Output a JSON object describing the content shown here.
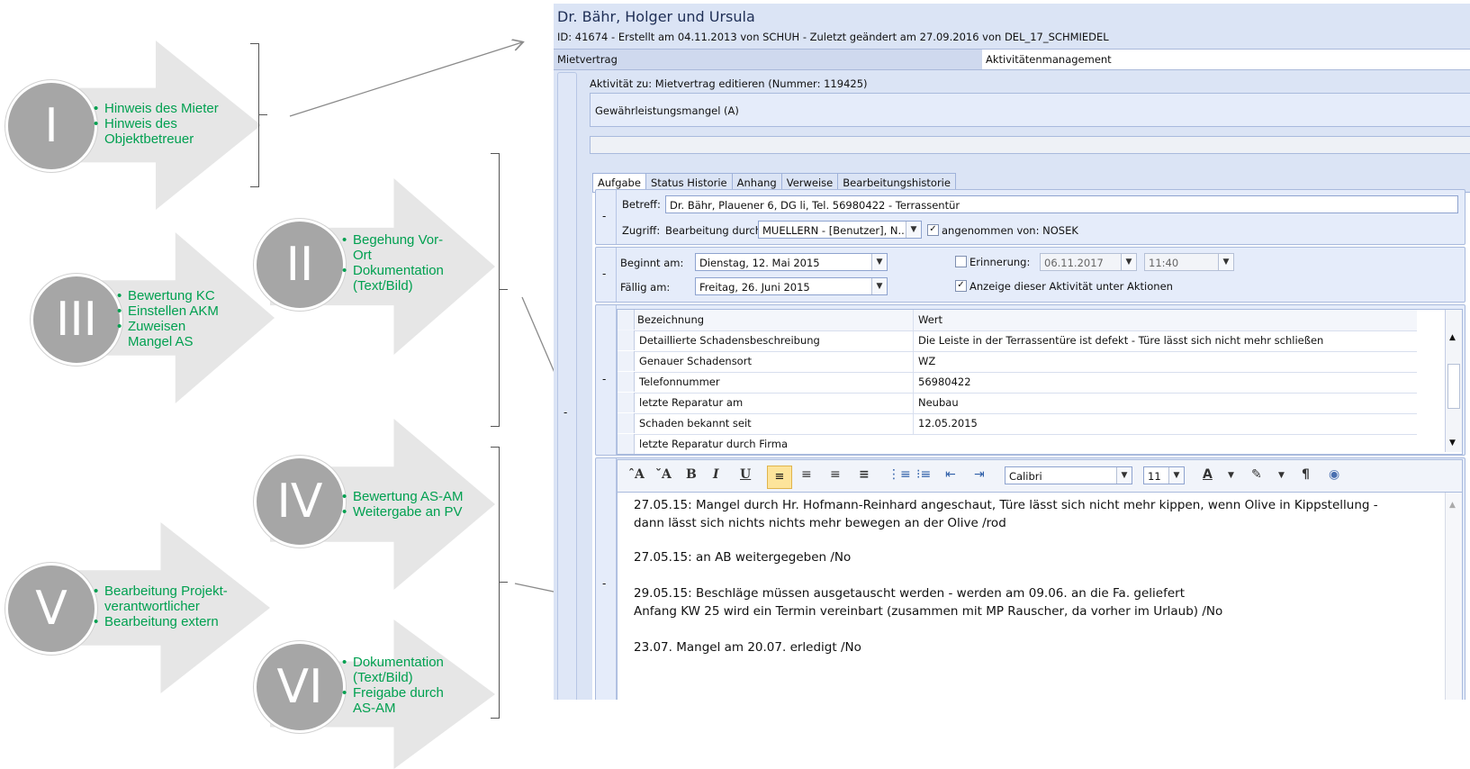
{
  "diagram": {
    "steps": [
      {
        "numeral": "I",
        "items": [
          "Hinweis des Mieter",
          "Hinweis  des Objektbetreuer"
        ]
      },
      {
        "numeral": "II",
        "items": [
          "Begehung Vor-Ort",
          "Dokumentation (Text/Bild)"
        ]
      },
      {
        "numeral": "III",
        "items": [
          "Bewertung KC",
          "Einstellen AKM",
          "Zuweisen Mangel AS"
        ]
      },
      {
        "numeral": "IV",
        "items": [
          "Bewertung AS-AM",
          "Weitergabe an PV"
        ]
      },
      {
        "numeral": "V",
        "items": [
          "Bearbeitung Projekt-verantwortlicher",
          "Bearbeitung extern"
        ]
      },
      {
        "numeral": "VI",
        "items": [
          "Dokumentation (Text/Bild)",
          "Freigabe durch AS-AM"
        ]
      }
    ],
    "colors": {
      "text_green": "#00a050",
      "badge_grey": "#a6a6a6",
      "arrow_grey": "#e6e6e6"
    }
  },
  "app": {
    "title": "Dr. Bähr, Holger und Ursula",
    "subtitle": "ID: 41674 - Erstellt am 04.11.2013 von SCHUH - Zuletzt geändert am 27.09.2016 von DEL_17_SCHMIEDEL",
    "tabs": [
      "Mietvertrag",
      "Aktivitätenmanagement"
    ],
    "activity_caption": "Aktivität zu: Mietvertrag editieren (Nummer: 119425)",
    "category": "Gewährleistungsmangel (A)",
    "sub_tabs": [
      "Aufgabe",
      "Status Historie",
      "Anhang",
      "Verweise",
      "Bearbeitungshistorie"
    ],
    "collapse": "-",
    "task": {
      "betreff_label": "Betreff:",
      "betreff_value": "Dr. Bähr, Plauener 6, DG li, Tel. 56980422 - Terrassentür",
      "zugriff_label": "Zugriff:",
      "bearbeitung_label": "Bearbeitung durch:",
      "bearbeitung_value": "MUELLERN - [Benutzer], N...",
      "angenommen_label": "angenommen  von: NOSEK",
      "angenommen_checked": "✓"
    },
    "dates": {
      "beginnt_label": "Beginnt am:",
      "beginnt_value": "Dienstag, 12. Mai 2015",
      "faellig_label": "Fällig am:",
      "faellig_value": "Freitag, 26. Juni 2015",
      "erinnerung_label": "Erinnerung:",
      "erinnerung_date": "06.11.2017",
      "erinnerung_time": "11:40",
      "anzeige_label": "Anzeige dieser Aktivität unter Aktionen",
      "anzeige_checked": "✓"
    },
    "grid": {
      "headers": [
        "Bezeichnung",
        "Wert"
      ],
      "rows": [
        [
          "Detaillierte Schadensbeschreibung",
          "Die Leiste in der Terrassentüre ist defekt - Türe lässt sich nicht mehr schließen"
        ],
        [
          "Genauer Schadensort",
          "WZ"
        ],
        [
          "Telefonnummer",
          "56980422"
        ],
        [
          "letzte Reparatur am",
          "Neubau"
        ],
        [
          "Schaden bekannt seit",
          "12.05.2015"
        ],
        [
          "letzte Reparatur durch Firma",
          ""
        ]
      ]
    },
    "toolbar": {
      "font": "Calibri",
      "size": "11"
    },
    "editor_lines": [
      "27.05.15: Mangel durch Hr. Hofmann-Reinhard angeschaut, Türe lässt sich nicht mehr kippen, wenn Olive in Kippstellung - dann lässt sich nichts nichts mehr bewegen an der Olive /rod",
      "27.05.15: an AB weitergegeben /No",
      "29.05.15: Beschläge müssen ausgetauscht werden - werden am 09.06. an die Fa. geliefert",
      "Anfang KW 25 wird ein Termin vereinbart (zusammen mit MP Rauscher, da vorher im Urlaub) /No",
      "23.07. Mangel am 20.07. erledigt /No"
    ]
  }
}
